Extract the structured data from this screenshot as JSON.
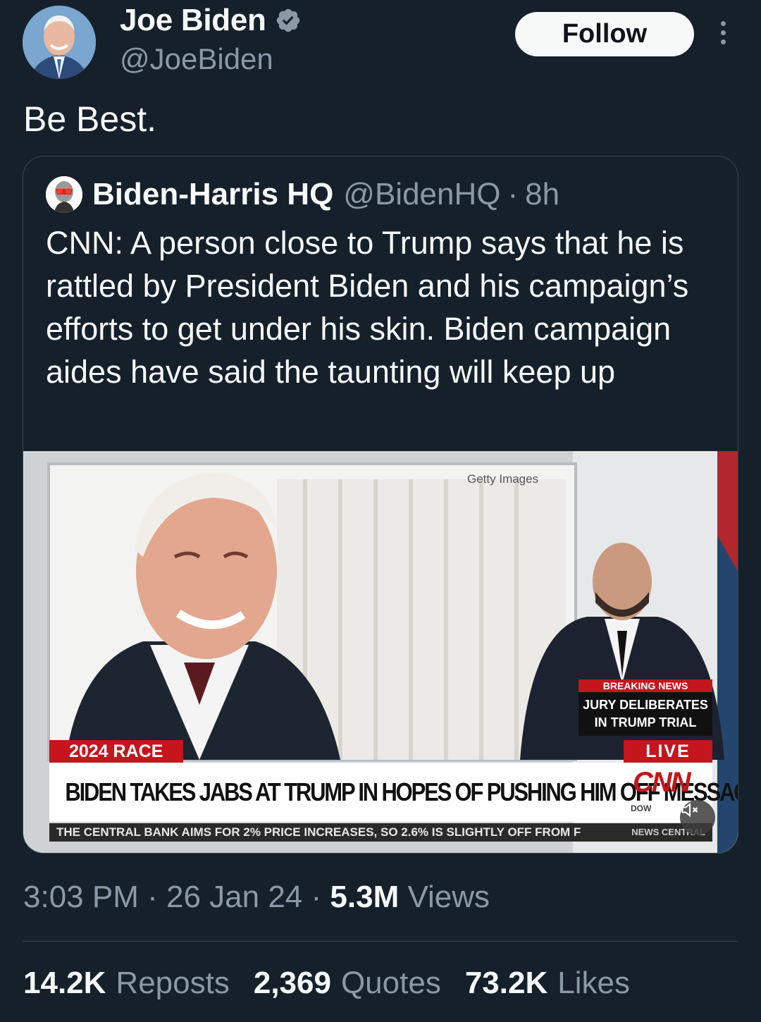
{
  "author": {
    "name": "Joe Biden",
    "handle": "@JoeBiden",
    "verified": true,
    "follow_label": "Follow"
  },
  "tweet": {
    "text": "Be Best."
  },
  "quoted": {
    "name": "Biden-Harris HQ",
    "handle": "@BidenHQ",
    "separator": "·",
    "time": "8h",
    "text": "CNN: A person close to Trump says that he is rattled by President Biden and his campaign’s efforts to get under his skin. Biden campaign aides have said the taunting will keep up",
    "media": {
      "watermark": "Getty Images",
      "breaking_label": "BREAKING NEWS",
      "breaking_text_line1": "JURY DELIBERATES",
      "breaking_text_line2": "IN TRUMP TRIAL",
      "race_label": "2024 RACE",
      "live_label": "LIVE",
      "headline": "BIDEN TAKES JABS AT TRUMP IN HOPES OF PUSHING HIM OFF MESSAGE",
      "network_logo": "CNN",
      "dow_label": "DOW",
      "ticker": "THE CENTRAL BANK AIMS FOR 2% PRICE INCREASES, SO 2.6% IS SLIGHTLY OFF FROM F",
      "ticker_tag": "NEWS CENTRAL",
      "mute_icon": "speaker-muted-icon"
    }
  },
  "meta": {
    "time": "3:03 PM",
    "sep1": "·",
    "date": "26 Jan 24",
    "sep2": "·",
    "views_count": "5.3M",
    "views_label": "Views"
  },
  "stats": {
    "reposts_count": "14.2K",
    "reposts_label": "Reposts",
    "quotes_count": "2,369",
    "quotes_label": "Quotes",
    "likes_count": "73.2K",
    "likes_label": "Likes"
  },
  "colors": {
    "background": "#15202b",
    "text": "#f7f9f9",
    "secondary": "#8b98a5",
    "border": "#38444d",
    "verified": "#8b98a5",
    "cnn_red": "#c4161c"
  }
}
